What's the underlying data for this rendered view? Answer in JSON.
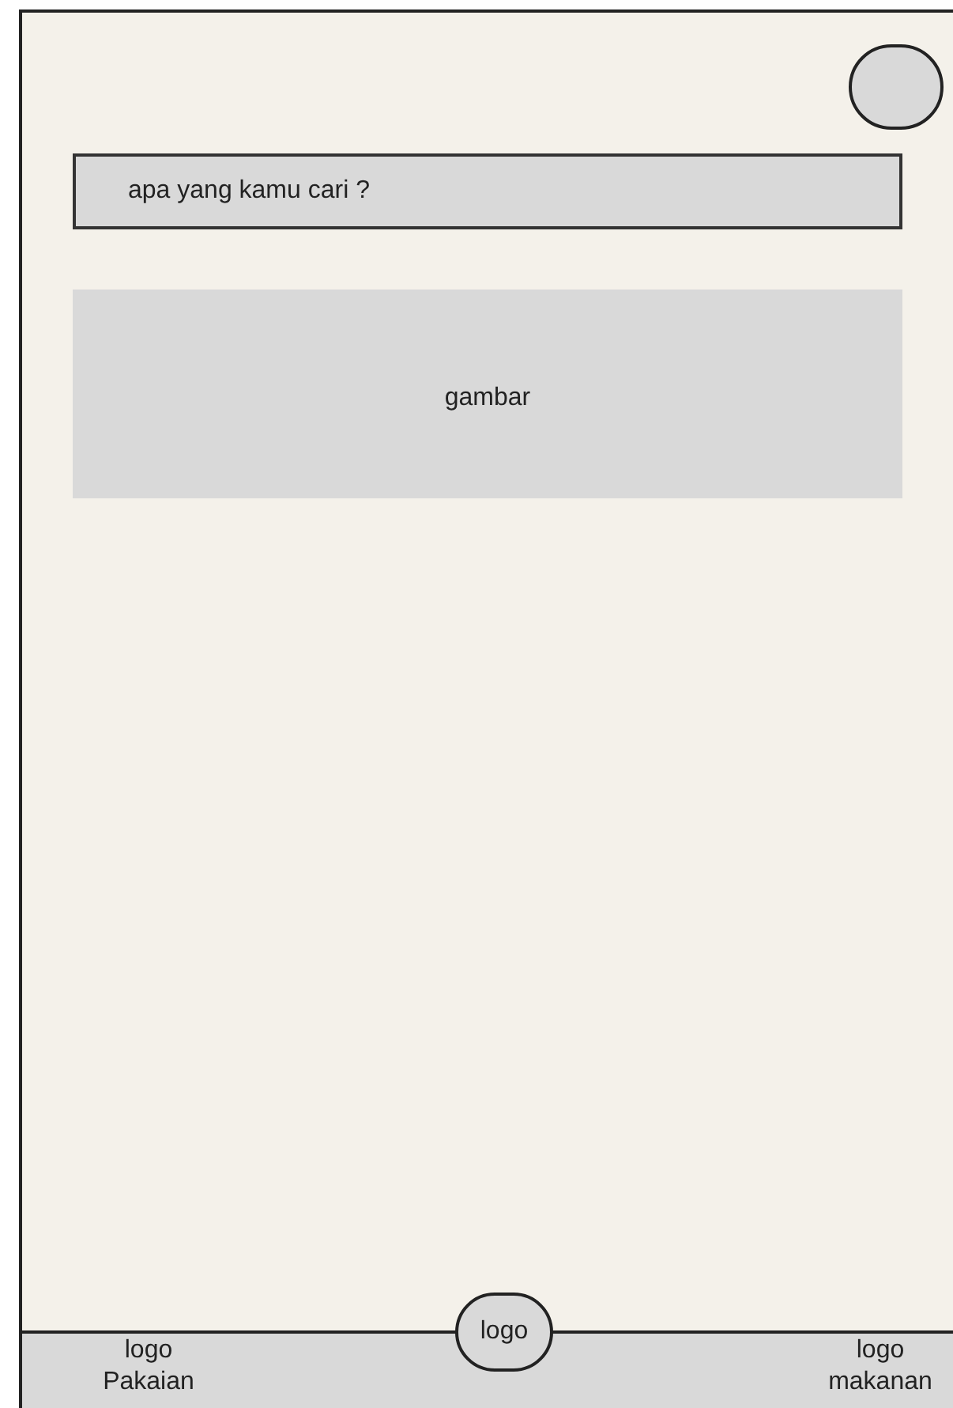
{
  "search": {
    "placeholder": "apa yang kamu cari ?"
  },
  "banner": {
    "label": "gambar"
  },
  "bottom_nav": [
    {
      "label": "logo Pakaian",
      "kind": "side"
    },
    {
      "label": "logo",
      "kind": "center"
    },
    {
      "label": "logo makanan",
      "kind": "side"
    }
  ]
}
